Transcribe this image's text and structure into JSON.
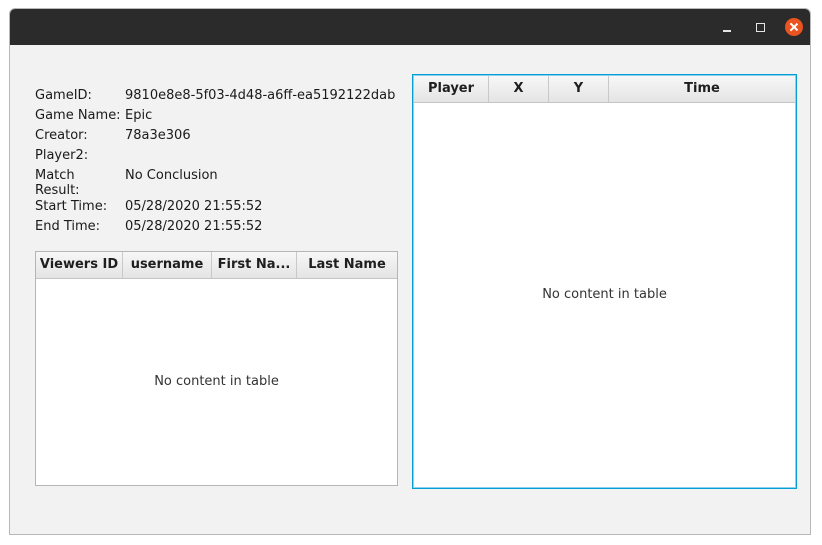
{
  "window": {
    "controls": [
      "minimize-icon",
      "maximize-icon",
      "close-icon"
    ]
  },
  "game_info": {
    "game_id_label": "GameID:",
    "game_id_value": "9810e8e8-5f03-4d48-a6ff-ea5192122dab",
    "game_name_label": "Game Name:",
    "game_name_value": "Epic",
    "creator_label": "Creator:",
    "creator_value": "78a3e306",
    "player2_label": "Player2:",
    "player2_value": "",
    "match_result_label": "Match Result:",
    "match_result_value": "No Conclusion",
    "start_time_label": "Start Time:",
    "start_time_value": "05/28/2020 21:55:52",
    "end_time_label": "End Time:",
    "end_time_value": "05/28/2020 21:55:52"
  },
  "viewers_table": {
    "columns": [
      "Viewers ID",
      "username",
      "First Na...",
      "Last Name"
    ],
    "rows": [],
    "empty_text": "No content in table"
  },
  "moves_table": {
    "columns": [
      "Player",
      "X",
      "Y",
      "Time"
    ],
    "rows": [],
    "empty_text": "No content in table"
  },
  "colors": {
    "title_bar": "#2b2b2b",
    "close_button": "#e95420",
    "focus_border": "#039ed3",
    "background": "#f2f2f2"
  }
}
